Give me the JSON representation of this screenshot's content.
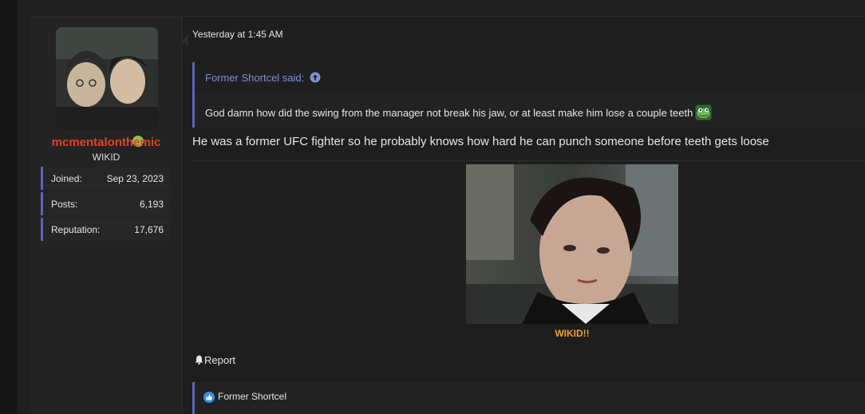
{
  "post": {
    "user": {
      "username": "mcmentalonthemic",
      "title": "WIKID",
      "stats": [
        {
          "label": "Joined:",
          "value": "Sep 23, 2023"
        },
        {
          "label": "Posts:",
          "value": "6,193"
        },
        {
          "label": "Reputation:",
          "value": "17,676"
        }
      ],
      "online": true
    },
    "date": "Yesterday at 1:45 AM",
    "quote": {
      "author": "Former Shortcel said:",
      "text": "God damn how did the swing from the manager not break his jaw, or at least make him lose a couple teeth"
    },
    "message": "He was a former UFC fighter so he probably knows how hard he can punch someone before teeth gets loose",
    "image_caption": "WIKID!!",
    "report_label": "Report",
    "reactions": {
      "user": "Former Shortcel"
    }
  },
  "colors": {
    "username": "#e0452b",
    "accent": "#5b66b8",
    "caption": "#f0a030",
    "online": "#8ec24a"
  },
  "icons": {
    "quote_link": "arrow-up-circle-icon",
    "emoji": "frog-emoji-icon",
    "report": "bell-icon",
    "reaction": "like-icon"
  }
}
